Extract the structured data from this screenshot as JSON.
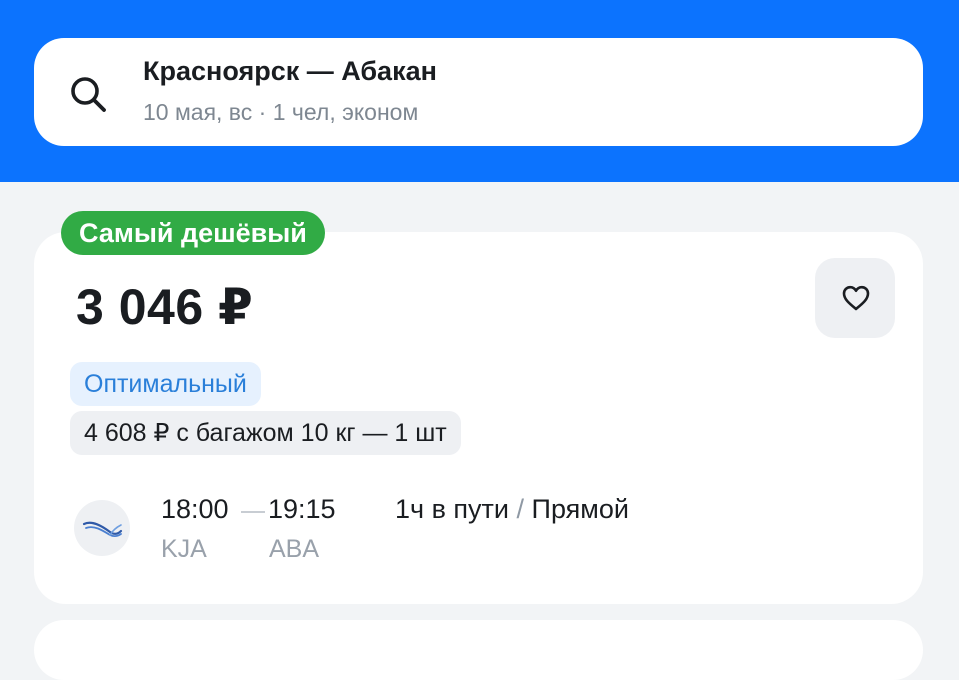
{
  "search": {
    "route": "Красноярск — Абакан",
    "details": "10 мая, вс · 1 чел, эконом"
  },
  "card": {
    "badge": "Самый дешёвый",
    "price": "3 046 ₽",
    "tariff": "Оптимальный",
    "baggage": "4 608 ₽ с багажом 10 кг — 1 шт",
    "flight": {
      "departure_time": "18:00",
      "arrival_time": "19:15",
      "departure_code": "KJA",
      "arrival_code": "ABA",
      "duration": "1ч в пути",
      "separator": "/",
      "type": "Прямой"
    }
  },
  "icons": {
    "search": "search-icon",
    "favorite": "heart-icon",
    "airline": "airline-logo"
  },
  "colors": {
    "header_bg": "#0c73fe",
    "badge_green": "#31ab45",
    "tariff_blue": "#2a7fd9"
  }
}
